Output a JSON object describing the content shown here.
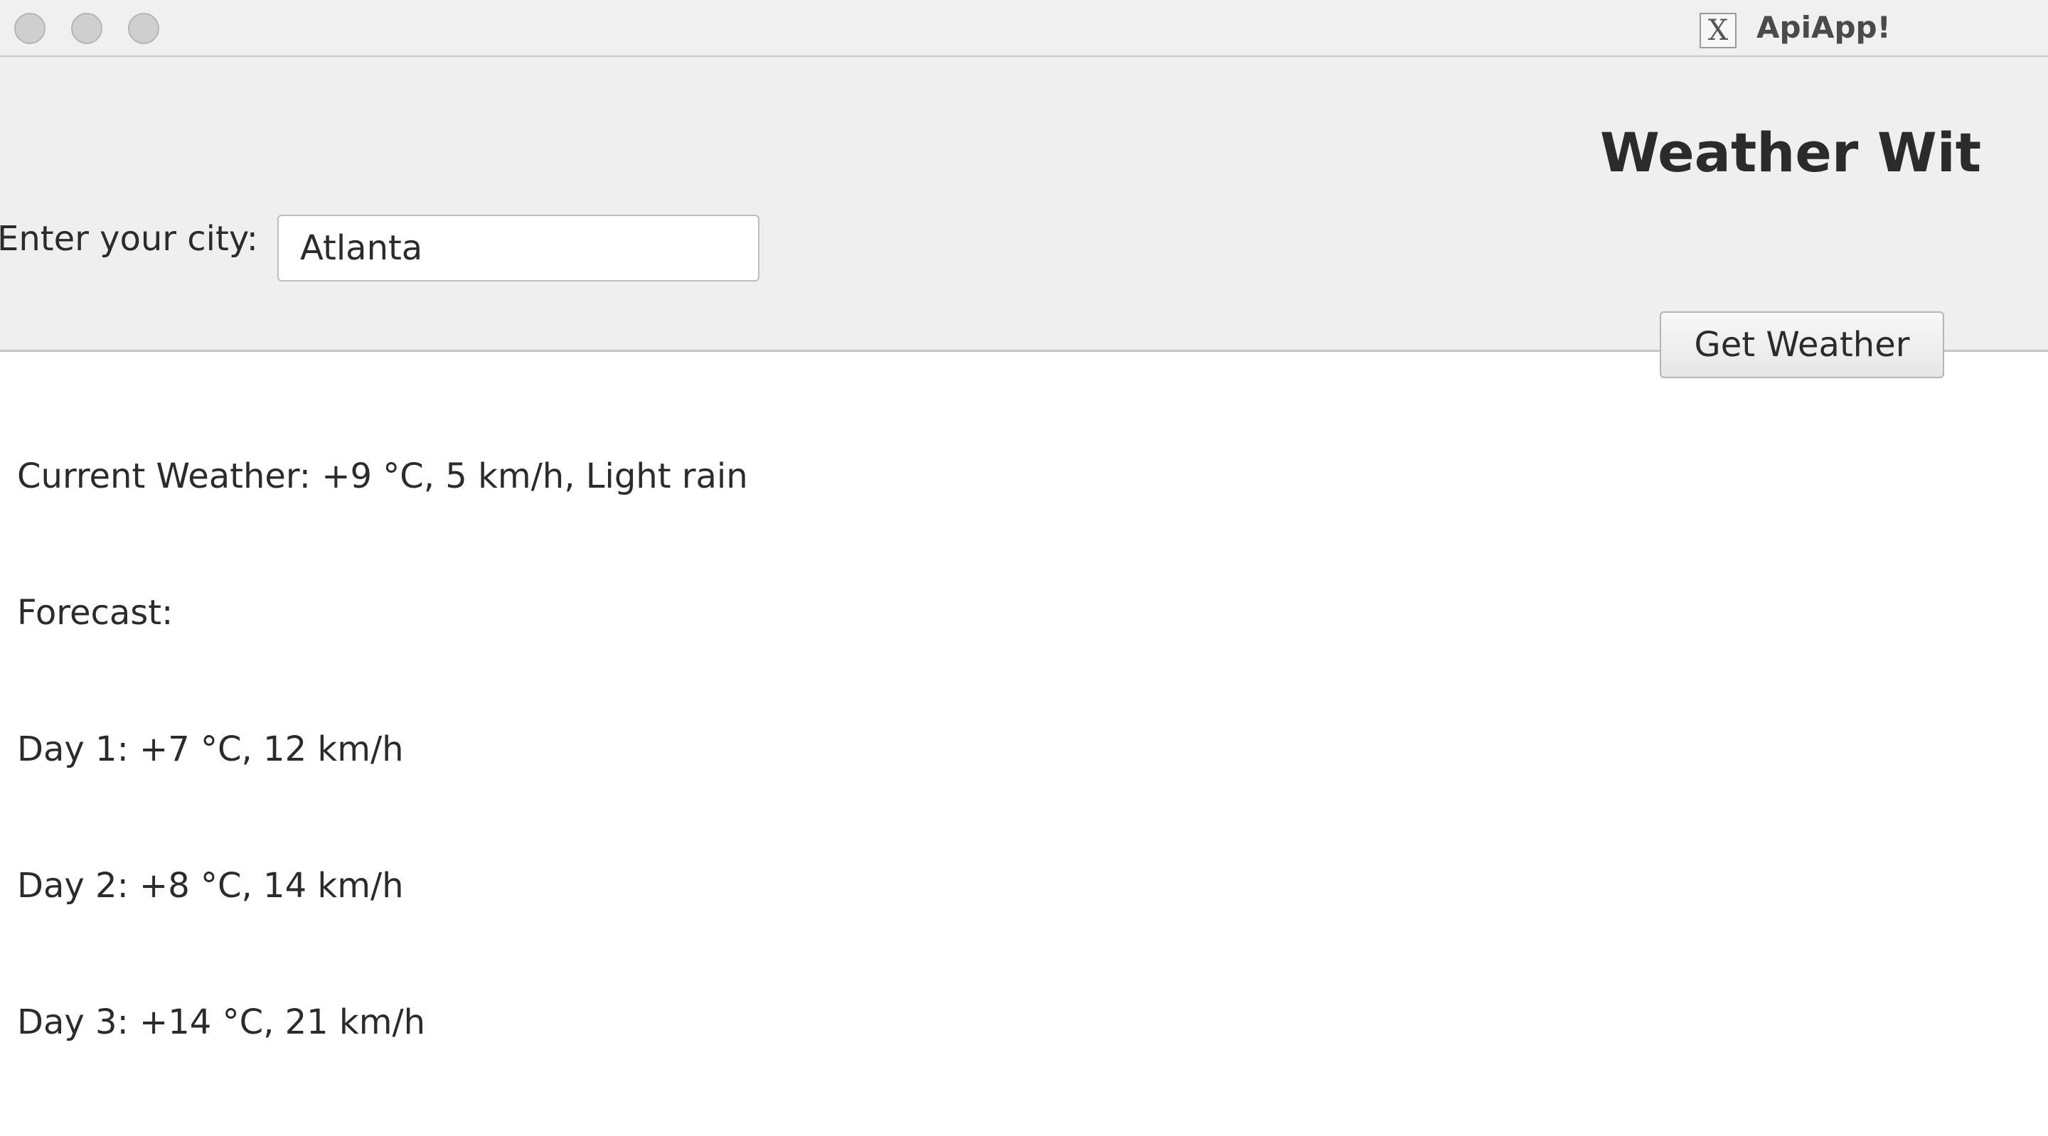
{
  "window": {
    "app_title": "ApiApp!",
    "app_icon_glyph": "X"
  },
  "panel": {
    "heading": "Weather Wit",
    "city_label": "Enter your city:",
    "city_value": "Atlanta",
    "button_label": "Get Weather"
  },
  "output": {
    "lines": [
      "Current Weather: +9 °C, 5 km/h, Light rain",
      "Forecast:",
      "Day 1: +7 °C, 12 km/h",
      "Day 2: +8 °C, 14 km/h",
      "Day 3: +14 °C, 21 km/h"
    ]
  },
  "colors": {
    "titlebar_bg": "#f0f0f0",
    "panel_bg": "#efefef",
    "text": "#2b2b2b",
    "traffic_light": "#cfcfcf"
  }
}
